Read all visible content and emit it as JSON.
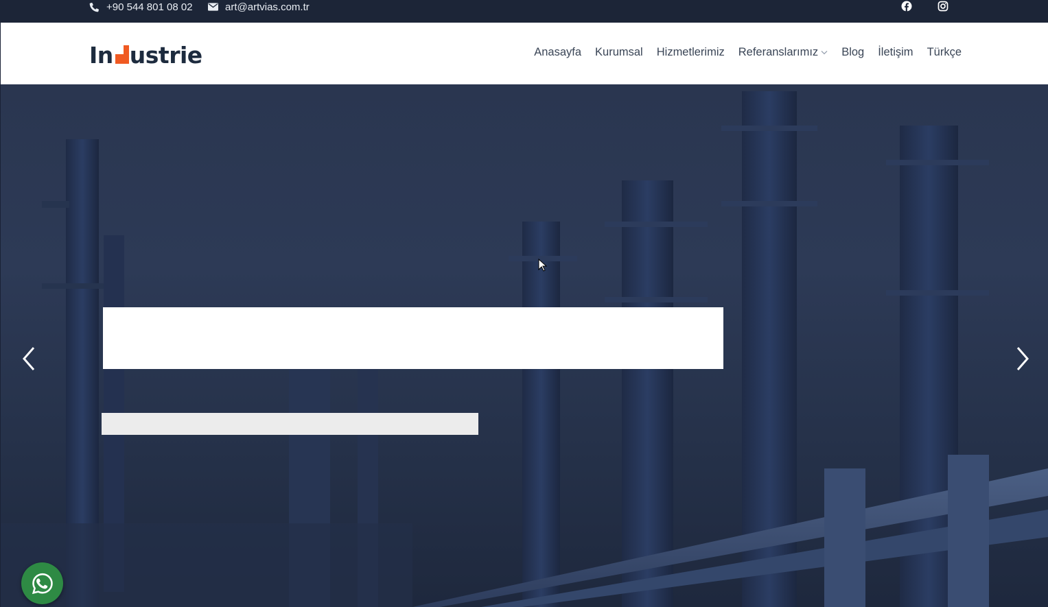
{
  "topbar": {
    "phone": "+90 544 801 08 02",
    "email": "art@artvias.com.tr",
    "social_icons": [
      "facebook-icon",
      "instagram-icon"
    ]
  },
  "header": {
    "logo_text_left": "In",
    "logo_text_right": "ustrie",
    "logo_accent_color": "#f05a22",
    "nav": [
      {
        "label": "Anasayfa"
      },
      {
        "label": "Kurumsal"
      },
      {
        "label": "Hizmetlerimiz"
      },
      {
        "label": "Referanslarımız",
        "has_dropdown": true
      },
      {
        "label": "Blog"
      },
      {
        "label": "İletişim"
      },
      {
        "label": "Türkçe"
      }
    ]
  },
  "hero": {
    "overlay_color": "#2a3650",
    "arrows": [
      "chevron-left-icon",
      "chevron-right-icon"
    ]
  },
  "floating": {
    "whatsapp_color": "#2e8a44",
    "icon": "whatsapp-icon"
  }
}
